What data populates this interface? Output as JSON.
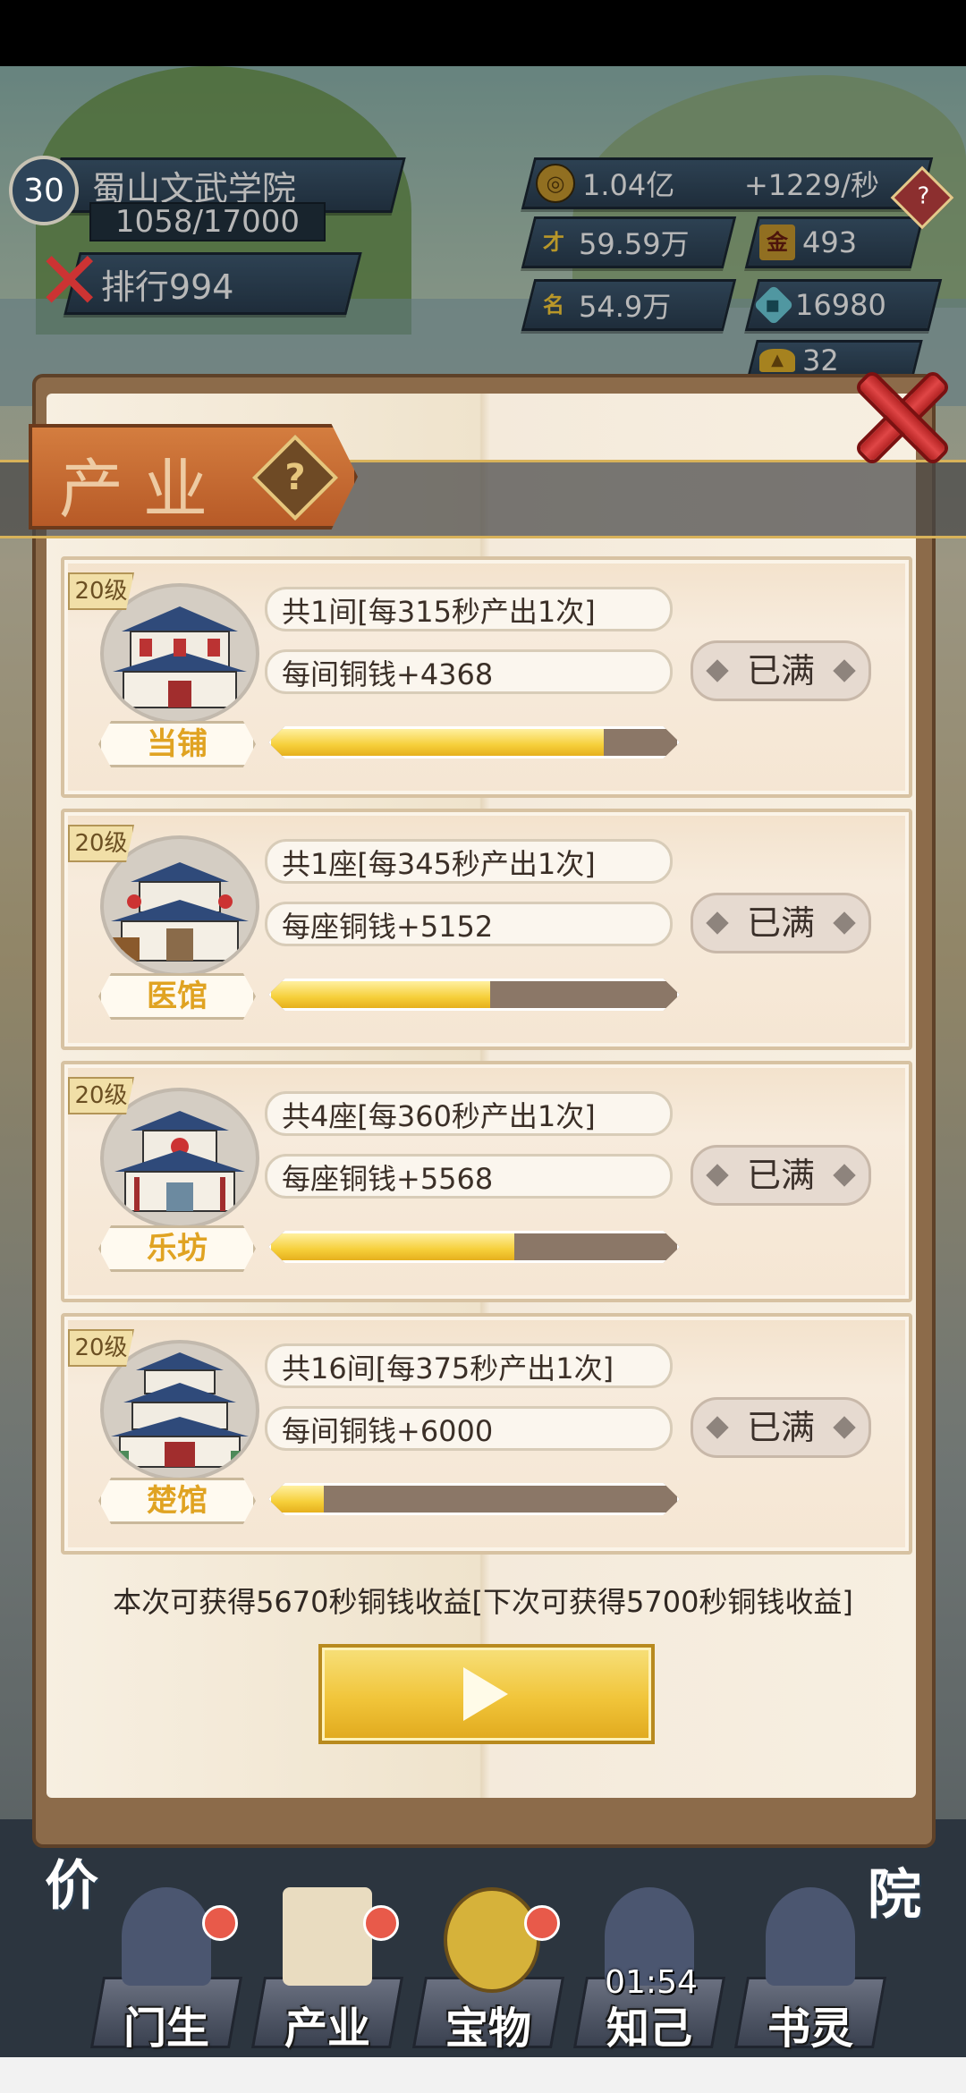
{
  "player": {
    "level": "30",
    "school_name": "蜀山文武学院",
    "exp": "1058/17000",
    "rank_label": "排行",
    "rank_value": "994"
  },
  "resources": {
    "coins": "1.04亿",
    "coin_rate": "+1229/秒",
    "talent": "59.59万",
    "gold_medal": "493",
    "fame": "54.9万",
    "jade": "16980",
    "ingot": "32"
  },
  "icons": {
    "coin": "coin-icon",
    "talent": "talent-calligraphy-icon",
    "gold": "gold-plaque-icon",
    "fame": "fame-calligraphy-icon",
    "jade": "jade-gem-icon",
    "ingot": "gold-ingot-icon"
  },
  "panel": {
    "title": "产业",
    "help": "?"
  },
  "industries": [
    {
      "level": "20级",
      "name": "当铺",
      "count_text": "共1间[每315秒产出1次]",
      "income_text": "每间铜钱+4368",
      "progress": 0.82,
      "status": "已满"
    },
    {
      "level": "20级",
      "name": "医馆",
      "count_text": "共1座[每345秒产出1次]",
      "income_text": "每座铜钱+5152",
      "progress": 0.54,
      "status": "已满"
    },
    {
      "level": "20级",
      "name": "乐坊",
      "count_text": "共4座[每360秒产出1次]",
      "income_text": "每座铜钱+5568",
      "progress": 0.6,
      "status": "已满"
    },
    {
      "level": "20级",
      "name": "楚馆",
      "count_text": "共16间[每375秒产出1次]",
      "income_text": "每间铜钱+6000",
      "progress": 0.13,
      "status": "已满"
    }
  ],
  "income_note": "本次可获得5670秒铜钱收益[下次可获得5700秒铜钱收益]",
  "side_labels": {
    "left": "价",
    "right": "院"
  },
  "nav": [
    {
      "label": "门生"
    },
    {
      "label": "产业"
    },
    {
      "label": "宝物"
    },
    {
      "label": "知己"
    },
    {
      "label": "书灵"
    }
  ],
  "timer": "01:54",
  "colors": {
    "accent_gold": "#f1c53a",
    "panel_orange": "#d47d3f",
    "name_gold": "#e0a322",
    "close_red": "#d63a3a"
  }
}
